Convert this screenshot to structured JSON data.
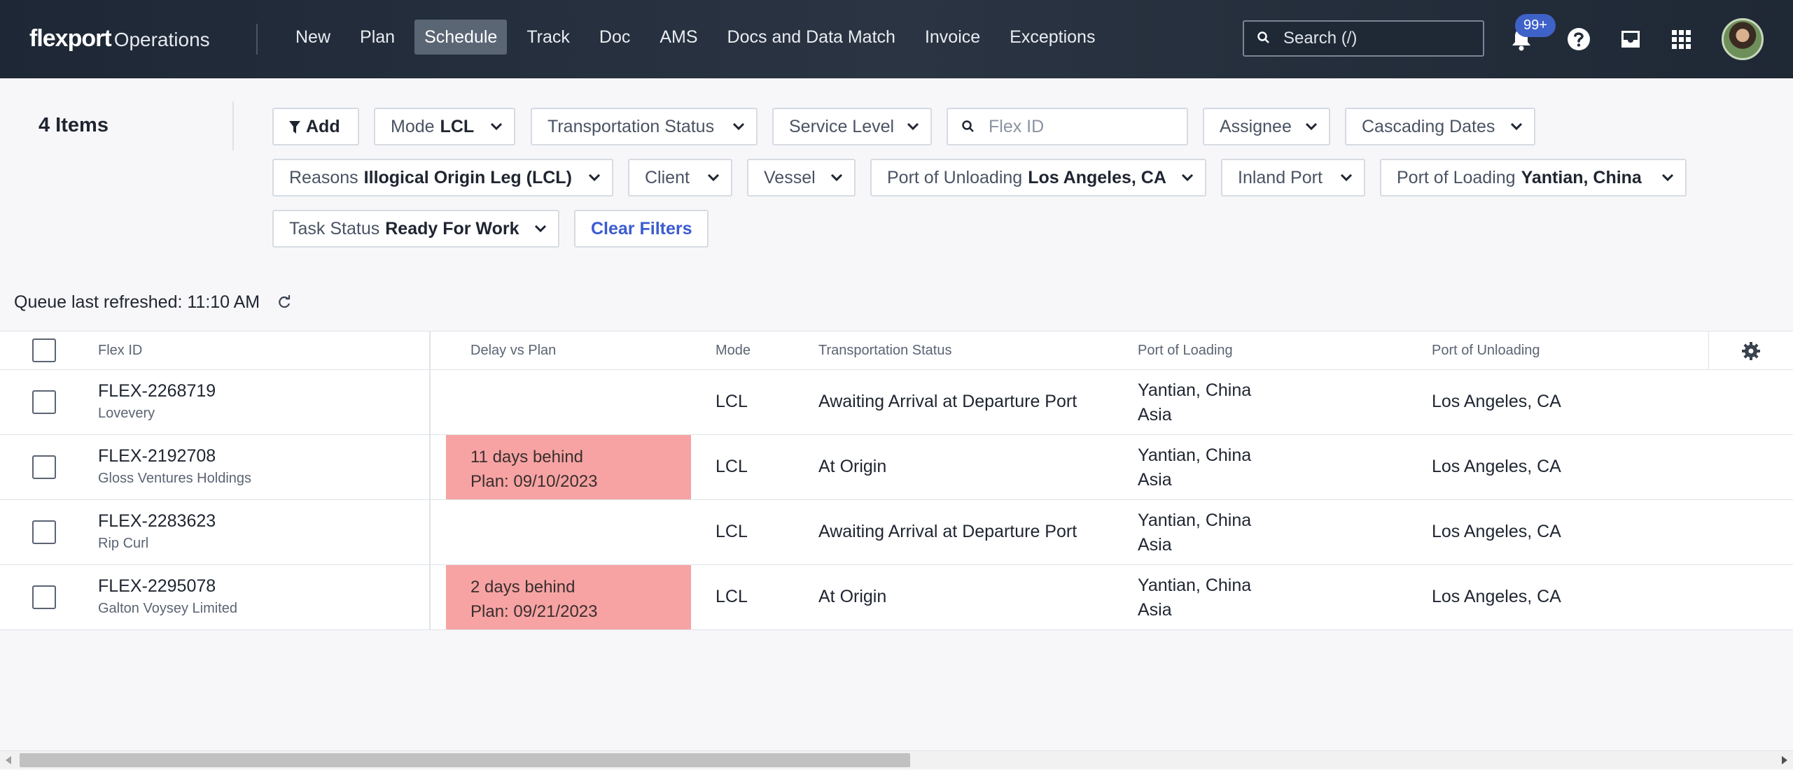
{
  "header": {
    "brand": "flexport",
    "brand_suffix": "Operations",
    "nav": [
      "New",
      "Plan",
      "Schedule",
      "Track",
      "Doc",
      "AMS",
      "Docs and Data Match",
      "Invoice",
      "Exceptions"
    ],
    "active_nav": "Schedule",
    "search_placeholder": "Search (/)",
    "notification_badge": "99+"
  },
  "filters": {
    "items_count": "4 Items",
    "add_label": "Add",
    "mode_label": "Mode",
    "mode_value": "LCL",
    "transportation_status": "Transportation Status",
    "service_level": "Service Level",
    "flex_id_placeholder": "Flex ID",
    "assignee": "Assignee",
    "cascading_dates": "Cascading Dates",
    "reasons_label": "Reasons",
    "reasons_value": "Illogical Origin Leg (LCL)",
    "client": "Client",
    "vessel": "Vessel",
    "pou_label": "Port of Unloading",
    "pou_value": "Los Angeles, CA",
    "inland_port": "Inland Port",
    "pol_label": "Port of Loading",
    "pol_value": "Yantian, China",
    "task_status_label": "Task Status",
    "task_status_value": "Ready For Work",
    "clear_filters": "Clear Filters"
  },
  "queue": {
    "refreshed": "Queue last refreshed: 11:10 AM"
  },
  "table": {
    "headers": {
      "flex_id": "Flex ID",
      "delay": "Delay vs Plan",
      "mode": "Mode",
      "status": "Transportation Status",
      "pol": "Port of Loading",
      "pou": "Port of Unloading"
    },
    "rows": [
      {
        "id": "FLEX-2268719",
        "client": "Lovevery",
        "delay": "",
        "plan": "",
        "mode": "LCL",
        "status": "Awaiting Arrival at Departure Port",
        "pol": "Yantian, China",
        "region": "Asia",
        "pou": "Los Angeles, CA"
      },
      {
        "id": "FLEX-2192708",
        "client": "Gloss Ventures Holdings",
        "delay": "11 days behind",
        "plan": "Plan: 09/10/2023",
        "mode": "LCL",
        "status": "At Origin",
        "pol": "Yantian, China",
        "region": "Asia",
        "pou": "Los Angeles, CA"
      },
      {
        "id": "FLEX-2283623",
        "client": "Rip Curl",
        "delay": "",
        "plan": "",
        "mode": "LCL",
        "status": "Awaiting Arrival at Departure Port",
        "pol": "Yantian, China",
        "region": "Asia",
        "pou": "Los Angeles, CA"
      },
      {
        "id": "FLEX-2295078",
        "client": "Galton Voysey Limited",
        "delay": "2 days behind",
        "plan": "Plan: 09/21/2023",
        "mode": "LCL",
        "status": "At Origin",
        "pol": "Yantian, China",
        "region": "Asia",
        "pou": "Los Angeles, CA"
      }
    ]
  }
}
